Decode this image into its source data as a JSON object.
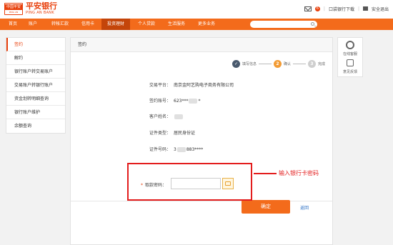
{
  "brand": {
    "logo_top": "中国平安",
    "logo_bottom": "PING AN",
    "name_cn": "平安银行",
    "name_en": "PING AN BANK"
  },
  "topbar": {
    "mail_count": "6",
    "download_label": "口袋银行下载",
    "safe_exit_label": "安全退出"
  },
  "nav": {
    "items": [
      "首页",
      "账户",
      "转帐汇款",
      "信用卡",
      "投资理财",
      "个人贷款",
      "生活服务",
      "更多业务"
    ],
    "active_index": 4
  },
  "search": {
    "placeholder": ""
  },
  "sidebar": {
    "items": [
      "签约",
      "解约",
      "银行账户转交易账户",
      "交易账户转银行账户",
      "资金划转明细查询",
      "银行账户维护",
      "余额查询"
    ],
    "active_index": 0
  },
  "main": {
    "title": "签约",
    "steps": [
      {
        "num": "",
        "label": "填写信息"
      },
      {
        "num": "2",
        "label": "确认"
      },
      {
        "num": "3",
        "label": "完成"
      }
    ],
    "fields": [
      {
        "label": "交易平台：",
        "value": "南京金阿艺购电子商务有限公司"
      },
      {
        "label": "签约账号：",
        "value": "623***"
      },
      {
        "label": "客户姓名：",
        "value": ""
      },
      {
        "label": "证件类型：",
        "value": "居民身份证"
      },
      {
        "label": "证件号码：",
        "value": "3"
      }
    ],
    "field_suffix": {
      "account": "*",
      "idno": "883****"
    },
    "password": {
      "required_mark": "*",
      "label": "取款密码：",
      "value": ""
    },
    "confirm_label": "确定",
    "back_label": "返回"
  },
  "annotation": {
    "text": "输入银行卡密码"
  },
  "right_panel": {
    "service_label": "在线客服",
    "feedback_label": "意见反馈"
  },
  "colors": {
    "brand_orange": "#f36b1b",
    "accent_red": "#e8400c",
    "annotation_red": "#e31d1d",
    "link_blue": "#2a6fc4"
  }
}
